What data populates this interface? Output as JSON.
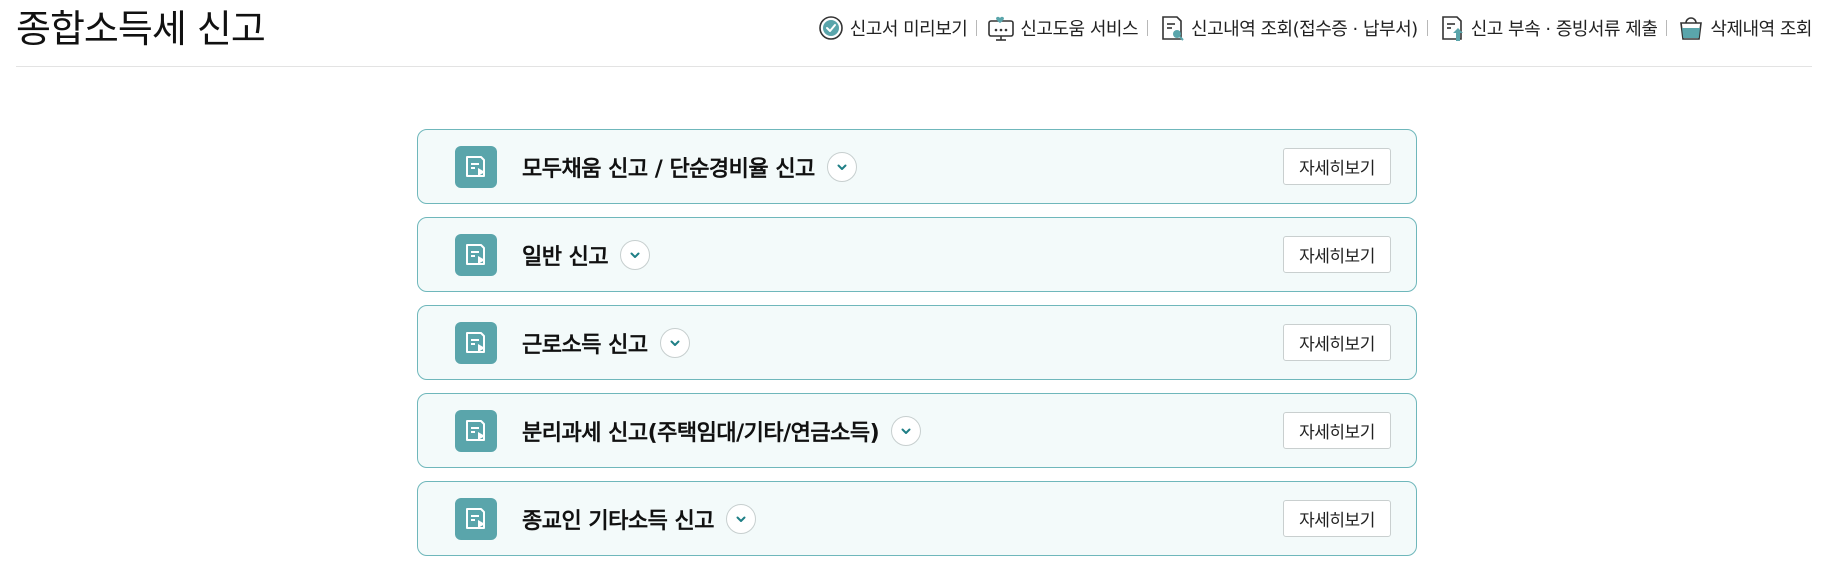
{
  "header": {
    "title": "종합소득세 신고"
  },
  "toolbar": {
    "items": [
      {
        "label": "신고서 미리보기",
        "icon": "check-circle-icon"
      },
      {
        "label": "신고도움 서비스",
        "icon": "monitor-heart-icon"
      },
      {
        "label": "신고내역 조회(접수증 · 납부서)",
        "icon": "document-search-icon"
      },
      {
        "label": "신고 부속 · 증빙서류 제출",
        "icon": "document-upload-icon"
      },
      {
        "label": "삭제내역 조회",
        "icon": "trash-basket-icon"
      }
    ]
  },
  "cards": [
    {
      "title": "모두채움 신고 / 단순경비율 신고",
      "button": "자세히보기",
      "icon": "report-icon"
    },
    {
      "title": "일반 신고",
      "button": "자세히보기",
      "icon": "report-icon"
    },
    {
      "title": "근로소득 신고",
      "button": "자세히보기",
      "icon": "report-icon"
    },
    {
      "title": "분리과세 신고(주택임대/기타/연금소득)",
      "button": "자세히보기",
      "icon": "report-icon"
    },
    {
      "title": "종교인 기타소득 신고",
      "button": "자세히보기",
      "icon": "report-icon"
    }
  ],
  "colors": {
    "accent": "#5aa5ab",
    "card_bg": "#f3fafa",
    "card_border": "#6fb7bb"
  }
}
